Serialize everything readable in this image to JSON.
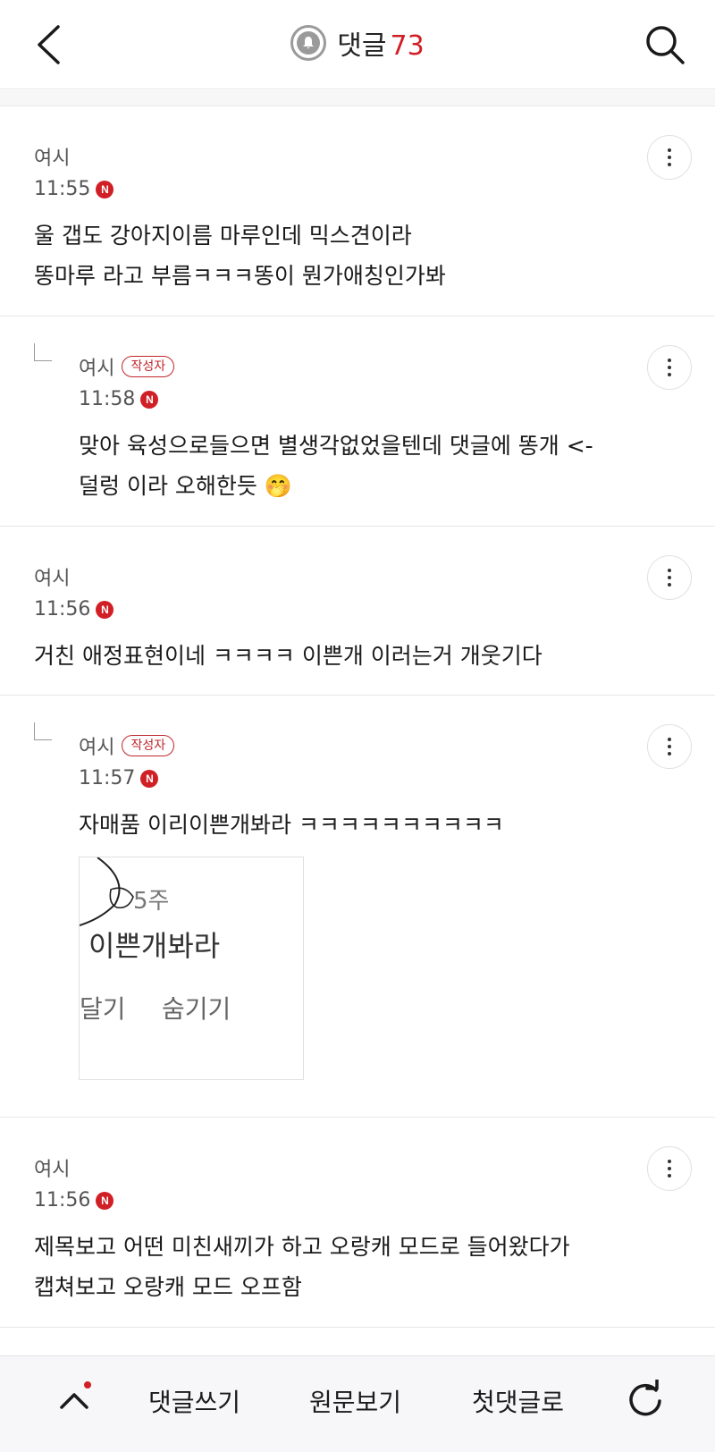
{
  "header": {
    "title": "댓글",
    "count": "73"
  },
  "comments": [
    {
      "author": "여시",
      "time": "11:55",
      "new_badge": "N",
      "text": "울 갭도 강아지이름 마루인데 믹스견이라\n똥마루 라고 부름ㅋㅋㅋ똥이 뭔가애칭인가봐"
    },
    {
      "author": "여시",
      "author_badge": "작성자",
      "time": "11:58",
      "new_badge": "N",
      "text": "맞아 육성으로들으면 별생각없었을텐데 댓글에 똥개 <-\n덜렁 이라 오해한듯 🤭"
    },
    {
      "author": "여시",
      "time": "11:56",
      "new_badge": "N",
      "text": "거친 애정표현이네 ㅋㅋㅋㅋ 이쁜개 이러는거 개웃기다"
    },
    {
      "author": "여시",
      "author_badge": "작성자",
      "time": "11:57",
      "new_badge": "N",
      "text": "자매품 이리이쁜개봐라 ㅋㅋㅋㅋㅋㅋㅋㅋㅋㅋ",
      "image": {
        "line1": "5주",
        "line2": "이쁜개봐라",
        "action1": "달기",
        "action2": "숨기기"
      }
    },
    {
      "author": "여시",
      "time": "11:56",
      "new_badge": "N",
      "text": "제목보고 어떤 미친새끼가 하고 오랑캐 모드로 들어왔다가\n캡쳐보고 오랑캐 모드 오프함"
    }
  ],
  "bottom_bar": {
    "write_comment": "댓글쓰기",
    "view_original": "원문보기",
    "first_comment": "첫댓글로"
  },
  "colors": {
    "accent": "#d11f26",
    "text": "#1a1a1a",
    "muted": "#555555"
  }
}
